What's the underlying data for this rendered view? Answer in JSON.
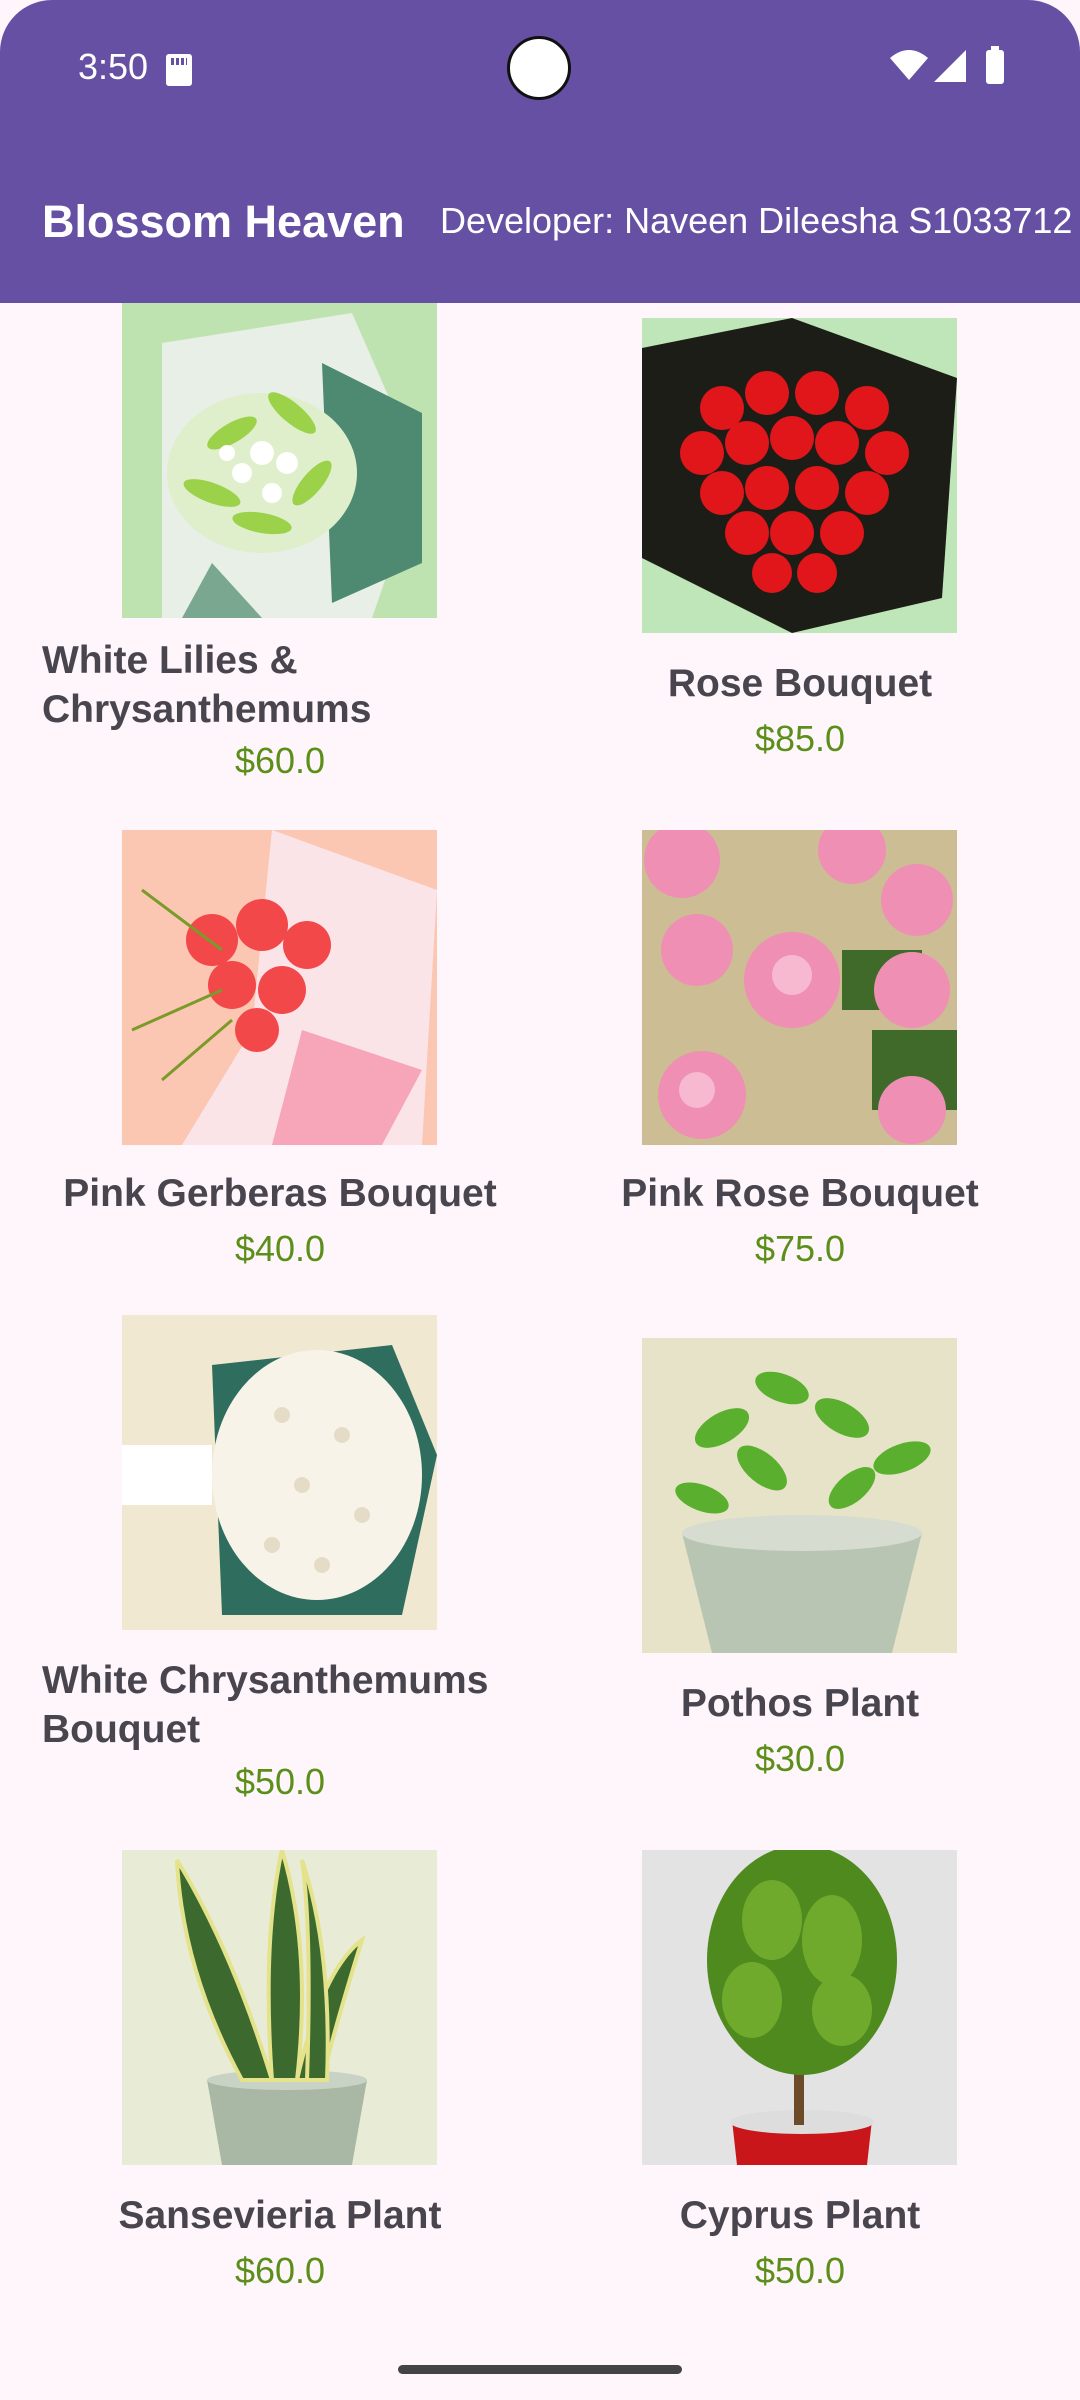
{
  "status_bar": {
    "time": "3:50"
  },
  "app_bar": {
    "title": "Blossom Heaven",
    "developer": "Developer: Naveen Dileesha S1033712",
    "color": "#6650a4"
  },
  "products": [
    {
      "name": "White Lilies & Chrysanthemums",
      "price": "$60.0",
      "icon": "white-lilies-bouquet-image"
    },
    {
      "name": "Rose Bouquet",
      "price": "$85.0",
      "icon": "rose-bouquet-image"
    },
    {
      "name": "Pink Gerberas Bouquet",
      "price": "$40.0",
      "icon": "pink-gerberas-image"
    },
    {
      "name": "Pink Rose Bouquet",
      "price": "$75.0",
      "icon": "pink-rose-image"
    },
    {
      "name": "White Chrysanthemums Bouquet",
      "price": "$50.0",
      "icon": "white-chrysanthemums-image"
    },
    {
      "name": "Pothos Plant",
      "price": "$30.0",
      "icon": "pothos-plant-image"
    },
    {
      "name": "Sansevieria Plant",
      "price": "$60.0",
      "icon": "sansevieria-plant-image"
    },
    {
      "name": "Cyprus Plant",
      "price": "$50.0",
      "icon": "cyprus-plant-image"
    }
  ],
  "colors": {
    "price": "#5b8f1a",
    "name": "#49454f",
    "background": "#fef6fb"
  }
}
